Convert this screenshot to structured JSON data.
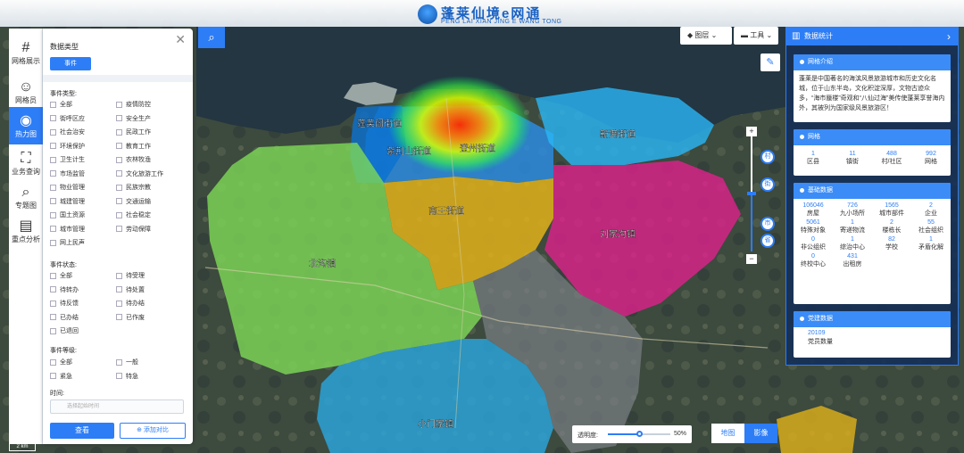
{
  "header": {
    "title": "蓬莱仙境e网通",
    "subtitle": "PENG LAI XIAN JING E WANG TONG"
  },
  "rail": {
    "items": [
      {
        "label": "网格展示",
        "icon": "grid-icon"
      },
      {
        "label": "网格员",
        "icon": "person-icon"
      },
      {
        "label": "热力图",
        "icon": "heatmap-icon"
      },
      {
        "label": "业务查询",
        "icon": "map-icon"
      },
      {
        "label": "专题图",
        "icon": "topic-icon"
      },
      {
        "label": "重点分析",
        "icon": "analysis-icon"
      }
    ],
    "active": "热力图"
  },
  "filter": {
    "data_type_title": "数据类型",
    "data_type_tag": "事件",
    "event_type_title": "事件类型:",
    "event_types": [
      [
        "全部",
        "疫情防控"
      ],
      [
        "街呼区应",
        "安全生产"
      ],
      [
        "社会治安",
        "民政工作"
      ],
      [
        "环境保护",
        "教育工作"
      ],
      [
        "卫生计生",
        "农林牧渔"
      ],
      [
        "市场监管",
        "文化旅游工作"
      ],
      [
        "物业管理",
        "民族宗教"
      ],
      [
        "城建管理",
        "交通运输"
      ],
      [
        "国土资源",
        "社会稳定"
      ],
      [
        "城市管理",
        "劳动保障"
      ],
      [
        "网上民声",
        ""
      ]
    ],
    "event_status_title": "事件状态:",
    "event_statuses": [
      [
        "全部",
        "待受理"
      ],
      [
        "待转办",
        "待处置"
      ],
      [
        "待反馈",
        "待办结"
      ],
      [
        "已办结",
        "已作废"
      ],
      [
        "已退回",
        ""
      ]
    ],
    "event_level_title": "事件等级:",
    "event_levels": [
      [
        "全部",
        "一般"
      ],
      [
        "紧急",
        "特急"
      ]
    ],
    "time_title": "时间:",
    "time_placeholder": "选择起始时间",
    "query_button": "查看",
    "add_compare_button": "添加对比"
  },
  "toolbar": {
    "layer_label": "图层",
    "tools_label": "工具"
  },
  "zoom_levels": [
    "村",
    "街",
    "市",
    "省"
  ],
  "zoom_fraction": 0.5,
  "stats": {
    "title": "数据统计",
    "intro_title": "网格介绍",
    "intro_text": "蓬莱是中国著名的海滨风景旅游城市和历史文化名城，位于山东半岛，文化积淀深厚，文物古迹众多，“海市蜃楼”奇观和“八仙过海”美传使蓬莱享誉海内外，其被列为国家级风景旅游区！",
    "grid_title": "网格",
    "grid_items": [
      {
        "value": "1",
        "label": "区县"
      },
      {
        "value": "11",
        "label": "镇街"
      },
      {
        "value": "488",
        "label": "村/社区"
      },
      {
        "value": "992",
        "label": "网格"
      }
    ],
    "basic_title": "基础数据",
    "basic_items": [
      {
        "value": "106046",
        "label": "房屋"
      },
      {
        "value": "726",
        "label": "九小场所"
      },
      {
        "value": "1565",
        "label": "城市部件"
      },
      {
        "value": "2",
        "label": "企业"
      },
      {
        "value": "5061",
        "label": "特殊对象"
      },
      {
        "value": "1",
        "label": "寄递物流"
      },
      {
        "value": "2",
        "label": "楼栋长"
      },
      {
        "value": "55",
        "label": "社会组织"
      },
      {
        "value": "0",
        "label": "非公组织"
      },
      {
        "value": "1",
        "label": "综治中心"
      },
      {
        "value": "82",
        "label": "学校"
      },
      {
        "value": "1",
        "label": "矛盾化解"
      },
      {
        "value": "0",
        "label": "终校中心"
      },
      {
        "value": "431",
        "label": "出租房"
      }
    ],
    "party_title": "党建数据",
    "party_value": "20109",
    "party_label": "党员数量"
  },
  "map": {
    "districts": [
      {
        "name": "蓬莱阁街道",
        "color": "#0aa8ff"
      },
      {
        "name": "新港街道",
        "color": "#29b6f6"
      },
      {
        "name": "紫荆山街道",
        "color": "#0a70d0"
      },
      {
        "name": "登州街道",
        "color": "#2a8ee8"
      },
      {
        "name": "南王街道",
        "color": "#e0b21a"
      },
      {
        "name": "刘家沟镇",
        "color": "#e0208c"
      },
      {
        "name": "北沟镇",
        "color": "#7ed957"
      },
      {
        "name": "小门家镇",
        "color": "#29a7e0"
      }
    ],
    "opacity_label": "透明度:",
    "opacity_value": "50%",
    "opacity_fraction": 0.5,
    "maptype_map": "地图",
    "maptype_image": "影像",
    "scale_label": "2 km"
  }
}
